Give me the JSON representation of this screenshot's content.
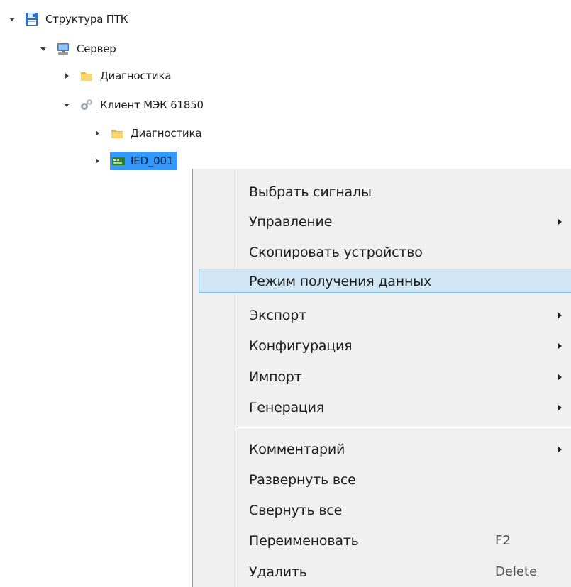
{
  "tree": {
    "nodes": [
      {
        "label": "Структура ПТК",
        "icon": "floppy-disk-icon",
        "expanded": true
      },
      {
        "label": "Сервер",
        "icon": "computer-icon",
        "expanded": true
      },
      {
        "label": "Диагностика",
        "icon": "folder-icon",
        "expanded": false
      },
      {
        "label": "Клиент МЭК 61850",
        "icon": "gears-icon",
        "expanded": true
      },
      {
        "label": "Диагностика",
        "icon": "folder-icon",
        "expanded": false
      },
      {
        "label": "IED_001",
        "icon": "ied-device-icon",
        "expanded": false,
        "selected": true
      }
    ]
  },
  "context_menu": {
    "items": [
      {
        "label": "Выбрать сигналы"
      },
      {
        "label": "Управление",
        "submenu": true
      },
      {
        "label": "Скопировать устройство"
      },
      {
        "label": "Режим получения данных",
        "highlighted": true
      },
      {
        "label": "Экспорт",
        "submenu": true
      },
      {
        "label": "Конфигурация",
        "submenu": true
      },
      {
        "label": "Импорт",
        "submenu": true
      },
      {
        "label": "Генерация",
        "submenu": true
      },
      {
        "label": "Комментарий",
        "submenu": true
      },
      {
        "label": "Развернуть все"
      },
      {
        "label": "Свернуть все"
      },
      {
        "label": "Переименовать",
        "shortcut": "F2"
      },
      {
        "label": "Удалить",
        "shortcut": "Delete"
      }
    ]
  },
  "colors": {
    "selection": "#3399ff",
    "menu_background": "#f0f0f0",
    "menu_highlight": "#d1e6f4",
    "menu_highlight_border": "#7fbce4"
  }
}
